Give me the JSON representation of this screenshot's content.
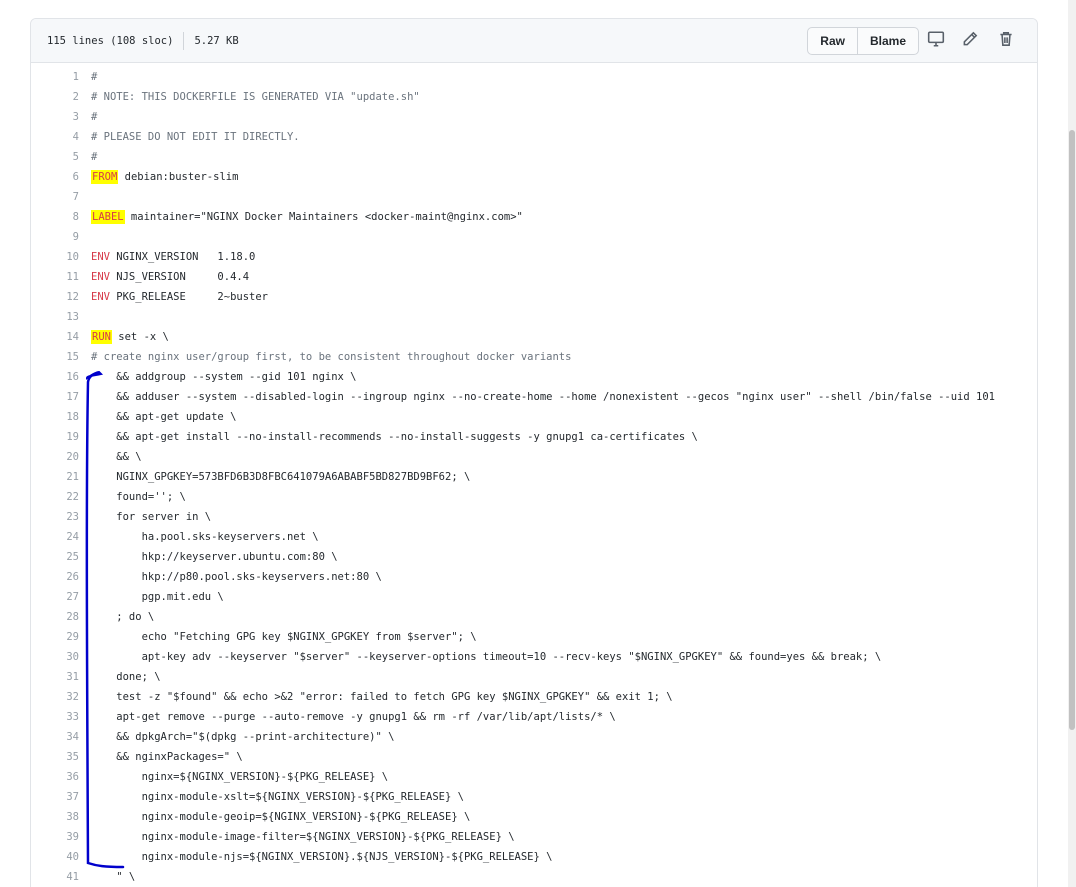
{
  "file_header": {
    "lines": "115 lines (108 sloc)",
    "size": "5.27 KB",
    "raw_label": "Raw",
    "blame_label": "Blame"
  },
  "icons": {
    "desktop": "desktop-icon",
    "pencil": "pencil-icon",
    "trash": "trash-icon"
  },
  "colors": {
    "keyword": "#d73a49",
    "highlight": "#ffff00",
    "annotation": "#0000cc"
  },
  "code_lines": [
    {
      "n": "1",
      "kw": "",
      "rest": "#",
      "cls": "cmt"
    },
    {
      "n": "2",
      "kw": "",
      "rest": "# NOTE: THIS DOCKERFILE IS GENERATED VIA \"update.sh\"",
      "cls": "cmt"
    },
    {
      "n": "3",
      "kw": "",
      "rest": "#",
      "cls": "cmt"
    },
    {
      "n": "4",
      "kw": "",
      "rest": "# PLEASE DO NOT EDIT IT DIRECTLY.",
      "cls": "cmt"
    },
    {
      "n": "5",
      "kw": "",
      "rest": "#",
      "cls": "cmt"
    },
    {
      "n": "6",
      "kw": "FROM",
      "hl": true,
      "rest": " debian:buster-slim",
      "cls": ""
    },
    {
      "n": "7",
      "kw": "",
      "rest": "",
      "cls": ""
    },
    {
      "n": "8",
      "kw": "LABEL",
      "hl": true,
      "rest": " maintainer=\"NGINX Docker Maintainers <docker-maint@nginx.com>\"",
      "cls": ""
    },
    {
      "n": "9",
      "kw": "",
      "rest": "",
      "cls": ""
    },
    {
      "n": "10",
      "kw": "ENV",
      "rest": " NGINX_VERSION   1.18.0",
      "cls": ""
    },
    {
      "n": "11",
      "kw": "ENV",
      "rest": " NJS_VERSION     0.4.4",
      "cls": ""
    },
    {
      "n": "12",
      "kw": "ENV",
      "rest": " PKG_RELEASE     2~buster",
      "cls": ""
    },
    {
      "n": "13",
      "kw": "",
      "rest": "",
      "cls": ""
    },
    {
      "n": "14",
      "kw": "RUN",
      "hl": true,
      "rest": " set -x \\",
      "cls": ""
    },
    {
      "n": "15",
      "kw": "",
      "rest": "# create nginx user/group first, to be consistent throughout docker variants",
      "cls": "cmt"
    },
    {
      "n": "16",
      "kw": "",
      "rest": "    && addgroup --system --gid 101 nginx \\",
      "cls": ""
    },
    {
      "n": "17",
      "kw": "",
      "rest": "    && adduser --system --disabled-login --ingroup nginx --no-create-home --home /nonexistent --gecos \"nginx user\" --shell /bin/false --uid 101",
      "cls": ""
    },
    {
      "n": "18",
      "kw": "",
      "rest": "    && apt-get update \\",
      "cls": ""
    },
    {
      "n": "19",
      "kw": "",
      "rest": "    && apt-get install --no-install-recommends --no-install-suggests -y gnupg1 ca-certificates \\",
      "cls": ""
    },
    {
      "n": "20",
      "kw": "",
      "rest": "    && \\",
      "cls": ""
    },
    {
      "n": "21",
      "kw": "",
      "rest": "    NGINX_GPGKEY=573BFD6B3D8FBC641079A6ABABF5BD827BD9BF62; \\",
      "cls": ""
    },
    {
      "n": "22",
      "kw": "",
      "rest": "    found=''; \\",
      "cls": ""
    },
    {
      "n": "23",
      "kw": "",
      "rest": "    for server in \\",
      "cls": ""
    },
    {
      "n": "24",
      "kw": "",
      "rest": "        ha.pool.sks-keyservers.net \\",
      "cls": ""
    },
    {
      "n": "25",
      "kw": "",
      "rest": "        hkp://keyserver.ubuntu.com:80 \\",
      "cls": ""
    },
    {
      "n": "26",
      "kw": "",
      "rest": "        hkp://p80.pool.sks-keyservers.net:80 \\",
      "cls": ""
    },
    {
      "n": "27",
      "kw": "",
      "rest": "        pgp.mit.edu \\",
      "cls": ""
    },
    {
      "n": "28",
      "kw": "",
      "rest": "    ; do \\",
      "cls": ""
    },
    {
      "n": "29",
      "kw": "",
      "rest": "        echo \"Fetching GPG key $NGINX_GPGKEY from $server\"; \\",
      "cls": ""
    },
    {
      "n": "30",
      "kw": "",
      "rest": "        apt-key adv --keyserver \"$server\" --keyserver-options timeout=10 --recv-keys \"$NGINX_GPGKEY\" && found=yes && break; \\",
      "cls": ""
    },
    {
      "n": "31",
      "kw": "",
      "rest": "    done; \\",
      "cls": ""
    },
    {
      "n": "32",
      "kw": "",
      "rest": "    test -z \"$found\" && echo >&2 \"error: failed to fetch GPG key $NGINX_GPGKEY\" && exit 1; \\",
      "cls": ""
    },
    {
      "n": "33",
      "kw": "",
      "rest": "    apt-get remove --purge --auto-remove -y gnupg1 && rm -rf /var/lib/apt/lists/* \\",
      "cls": ""
    },
    {
      "n": "34",
      "kw": "",
      "rest": "    && dpkgArch=\"$(dpkg --print-architecture)\" \\",
      "cls": ""
    },
    {
      "n": "35",
      "kw": "",
      "rest": "    && nginxPackages=\" \\",
      "cls": ""
    },
    {
      "n": "36",
      "kw": "",
      "rest": "        nginx=${NGINX_VERSION}-${PKG_RELEASE} \\",
      "cls": ""
    },
    {
      "n": "37",
      "kw": "",
      "rest": "        nginx-module-xslt=${NGINX_VERSION}-${PKG_RELEASE} \\",
      "cls": ""
    },
    {
      "n": "38",
      "kw": "",
      "rest": "        nginx-module-geoip=${NGINX_VERSION}-${PKG_RELEASE} \\",
      "cls": ""
    },
    {
      "n": "39",
      "kw": "",
      "rest": "        nginx-module-image-filter=${NGINX_VERSION}-${PKG_RELEASE} \\",
      "cls": ""
    },
    {
      "n": "40",
      "kw": "",
      "rest": "        nginx-module-njs=${NGINX_VERSION}.${NJS_VERSION}-${PKG_RELEASE} \\",
      "cls": ""
    },
    {
      "n": "41",
      "kw": "",
      "rest": "    \" \\",
      "cls": ""
    }
  ]
}
